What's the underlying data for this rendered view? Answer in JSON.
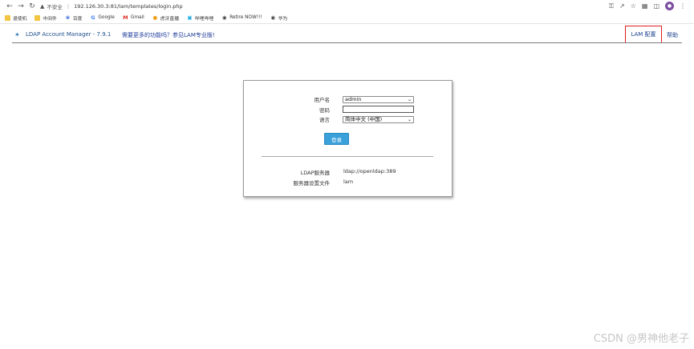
{
  "browser": {
    "security_label": "不安全",
    "url": "192.126.30.3:81/lam/templates/login.php",
    "bookmarks": [
      {
        "label": "退使机",
        "icon": "folder-icon"
      },
      {
        "label": "中间件",
        "icon": "folder-icon"
      },
      {
        "label": "百度",
        "icon": "baidu-icon"
      },
      {
        "label": "Google",
        "icon": "google-icon"
      },
      {
        "label": "Gmail",
        "icon": "gmail-icon"
      },
      {
        "label": "虎牙直播",
        "icon": "huya-icon"
      },
      {
        "label": "哔哩哔哩",
        "icon": "bilibili-icon"
      },
      {
        "label": "Retire NOW!!!",
        "icon": "site-icon"
      },
      {
        "label": "华为",
        "icon": "site-icon"
      }
    ]
  },
  "lam": {
    "title": "LDAP Account Manager - 7.9.1",
    "promo": "需要更多的功能吗？参见LAM专业版!",
    "config_link": "LAM 配置",
    "help_link": "帮助"
  },
  "login": {
    "user_label": "用户名",
    "user_value": "admin",
    "password_label": "密码",
    "language_label": "语言",
    "language_value": "简体中文 (中国)",
    "submit": "登录",
    "server_label": "LDAP服务器",
    "server_value": "ldap://openldap:389",
    "profile_label": "服务器设置文件",
    "profile_value": "lam"
  },
  "watermark": "CSDN @男神他老子"
}
